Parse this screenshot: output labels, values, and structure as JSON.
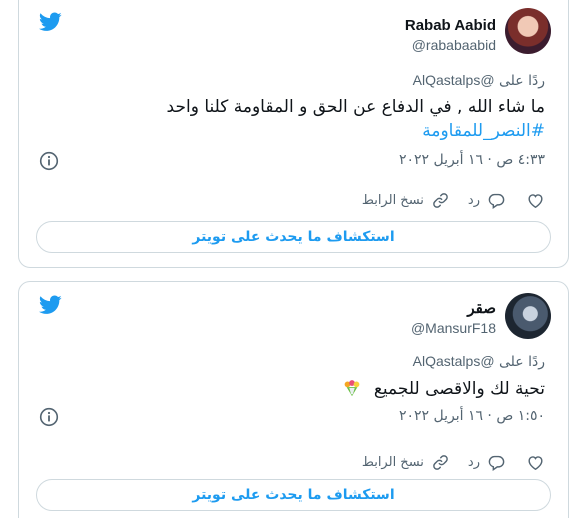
{
  "colors": {
    "accent": "#1d9bf0",
    "secondary_text": "#536471",
    "border": "#cfd9de"
  },
  "tweets": [
    {
      "display_name": "Rabab Aabid",
      "handle": "@rababaabid",
      "reply_prefix": "ردًا على",
      "reply_mention": "@AlQastalps",
      "text": "ما شاء الله , في الدفاع عن الحق و المقاومة كلنا واحد",
      "hashtag": "#النصر_للمقاومة",
      "timestamp": "٤:٣٣ ص · ١٦ أبريل ٢٠٢٢",
      "copy_link_label": "نسخ الرابط",
      "reply_label": "رد",
      "explore_label": "استكشاف ما يحدث على تويتر",
      "icons": [
        "twitter-bird-icon",
        "avatar",
        "info-icon",
        "heart-icon",
        "reply-icon",
        "link-icon"
      ]
    },
    {
      "display_name": "صقر",
      "handle": "@MansurF18",
      "reply_prefix": "ردًا على",
      "reply_mention": "@AlQastalps",
      "text": "تحية لك والاقصى للجميع",
      "timestamp": "١:٥٠ ص · ١٦ أبريل ٢٠٢٢",
      "copy_link_label": "نسخ الرابط",
      "reply_label": "رد",
      "explore_label": "استكشاف ما يحدث على تويتر",
      "icons": [
        "twitter-bird-icon",
        "avatar",
        "bouquet-emoji",
        "info-icon",
        "heart-icon",
        "reply-icon",
        "link-icon"
      ]
    }
  ]
}
